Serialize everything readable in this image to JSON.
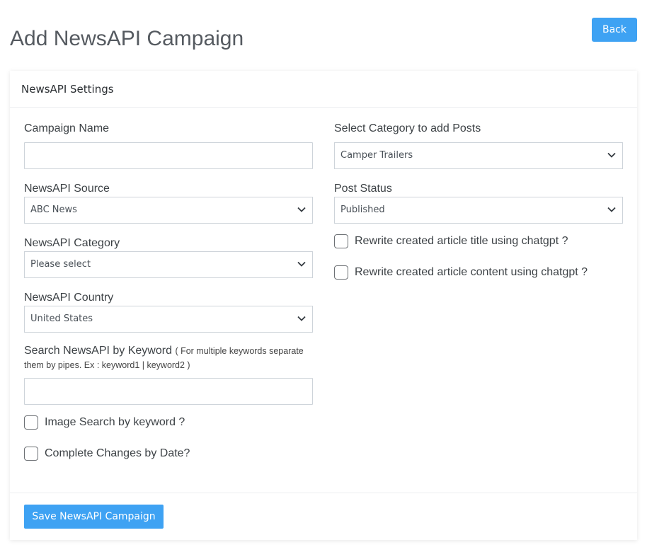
{
  "header": {
    "title": "Add NewsAPI Campaign",
    "back_label": "Back"
  },
  "card": {
    "title": "NewsAPI Settings"
  },
  "form": {
    "campaign_name": {
      "label": "Campaign Name",
      "value": ""
    },
    "source": {
      "label": "NewsAPI Source",
      "selected": "ABC News"
    },
    "category": {
      "label": "NewsAPI Category",
      "selected": "Please select"
    },
    "country": {
      "label": "NewsAPI Country",
      "selected": "United States"
    },
    "keyword": {
      "label": "Search NewsAPI by Keyword",
      "hint_line1": "( For multiple keywords separate",
      "hint_line2": "them by pipes. Ex : keyword1 | keyword2 )",
      "value": ""
    },
    "image_search": {
      "label": "Image Search by keyword ?",
      "checked": false
    },
    "complete_changes": {
      "label": "Complete Changes by Date?",
      "checked": false
    },
    "post_category": {
      "label": "Select Category to add Posts",
      "selected": "Camper Trailers"
    },
    "post_status": {
      "label": "Post Status",
      "selected": "Published"
    },
    "rewrite_title": {
      "label": "Rewrite created article title using chatgpt ?",
      "checked": false
    },
    "rewrite_content": {
      "label": "Rewrite created article content using chatgpt ?",
      "checked": false
    }
  },
  "footer": {
    "save_label": "Save NewsAPI Campaign"
  },
  "colors": {
    "primary": "#3ea2f3",
    "title_text": "#555a60",
    "border": "#ced4da"
  }
}
